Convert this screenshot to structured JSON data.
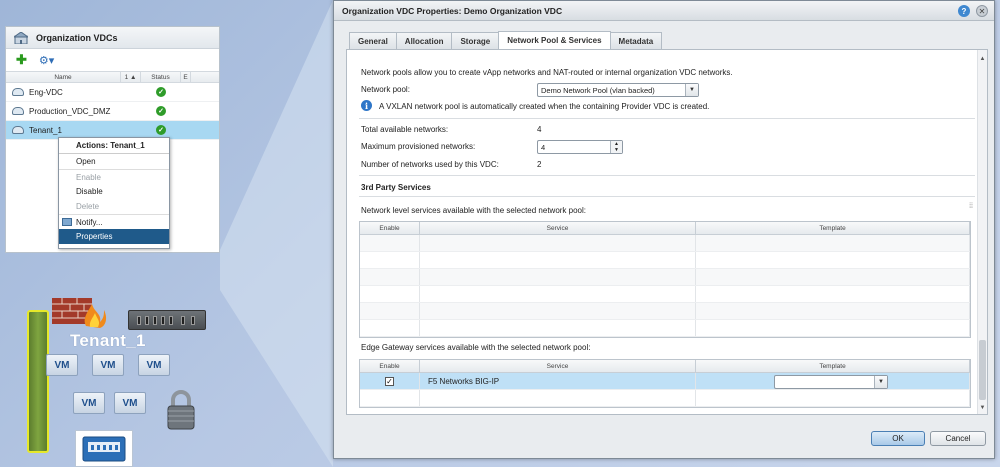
{
  "org_vdcs": {
    "title": "Organization VDCs",
    "columns": [
      "Name",
      "1 ▲",
      "Status",
      "E"
    ],
    "rows": [
      {
        "name": "Eng-VDC",
        "status": "ok"
      },
      {
        "name": "Production_VDC_DMZ",
        "status": "ok"
      },
      {
        "name": "Tenant_1",
        "status": "ok",
        "selected": true
      }
    ],
    "context_menu": {
      "title": "Actions: Tenant_1",
      "items": [
        {
          "label": "Open",
          "enabled": true
        },
        {
          "label": "Enable",
          "enabled": false
        },
        {
          "label": "Disable",
          "enabled": true
        },
        {
          "label": "Delete",
          "enabled": false
        },
        {
          "label": "Notify...",
          "enabled": true
        },
        {
          "label": "Properties",
          "enabled": true,
          "active": true
        }
      ]
    }
  },
  "diagram": {
    "tenant_label": "Tenant_1",
    "vm_label": "VM"
  },
  "dialog": {
    "title": "Organization VDC Properties: Demo Organization VDC",
    "tabs": [
      "General",
      "Allocation",
      "Storage",
      "Network Pool & Services",
      "Metadata"
    ],
    "active_tab": "Network Pool & Services",
    "intro": "Network pools allow you to create vApp networks and NAT-routed or internal organization VDC networks.",
    "network_pool_label": "Network pool:",
    "network_pool_value": "Demo Network Pool (vlan backed)",
    "vxlan_note": "A VXLAN network pool is automatically created when the containing Provider VDC is created.",
    "total_label": "Total available networks:",
    "total_value": "4",
    "max_label": "Maximum provisioned networks:",
    "max_value": "4",
    "used_label": "Number of networks used by this VDC:",
    "used_value": "2",
    "third_party_heading": "3rd Party Services",
    "network_services_label": "Network level services available with the selected network pool:",
    "edge_services_label": "Edge Gateway services available with the selected network pool:",
    "grid_columns": [
      "Enable",
      "Service",
      "Template"
    ],
    "edge_rows": [
      {
        "enabled": true,
        "service": "F5 Networks BIG-IP",
        "template": ""
      }
    ],
    "ok_label": "OK",
    "cancel_label": "Cancel"
  }
}
